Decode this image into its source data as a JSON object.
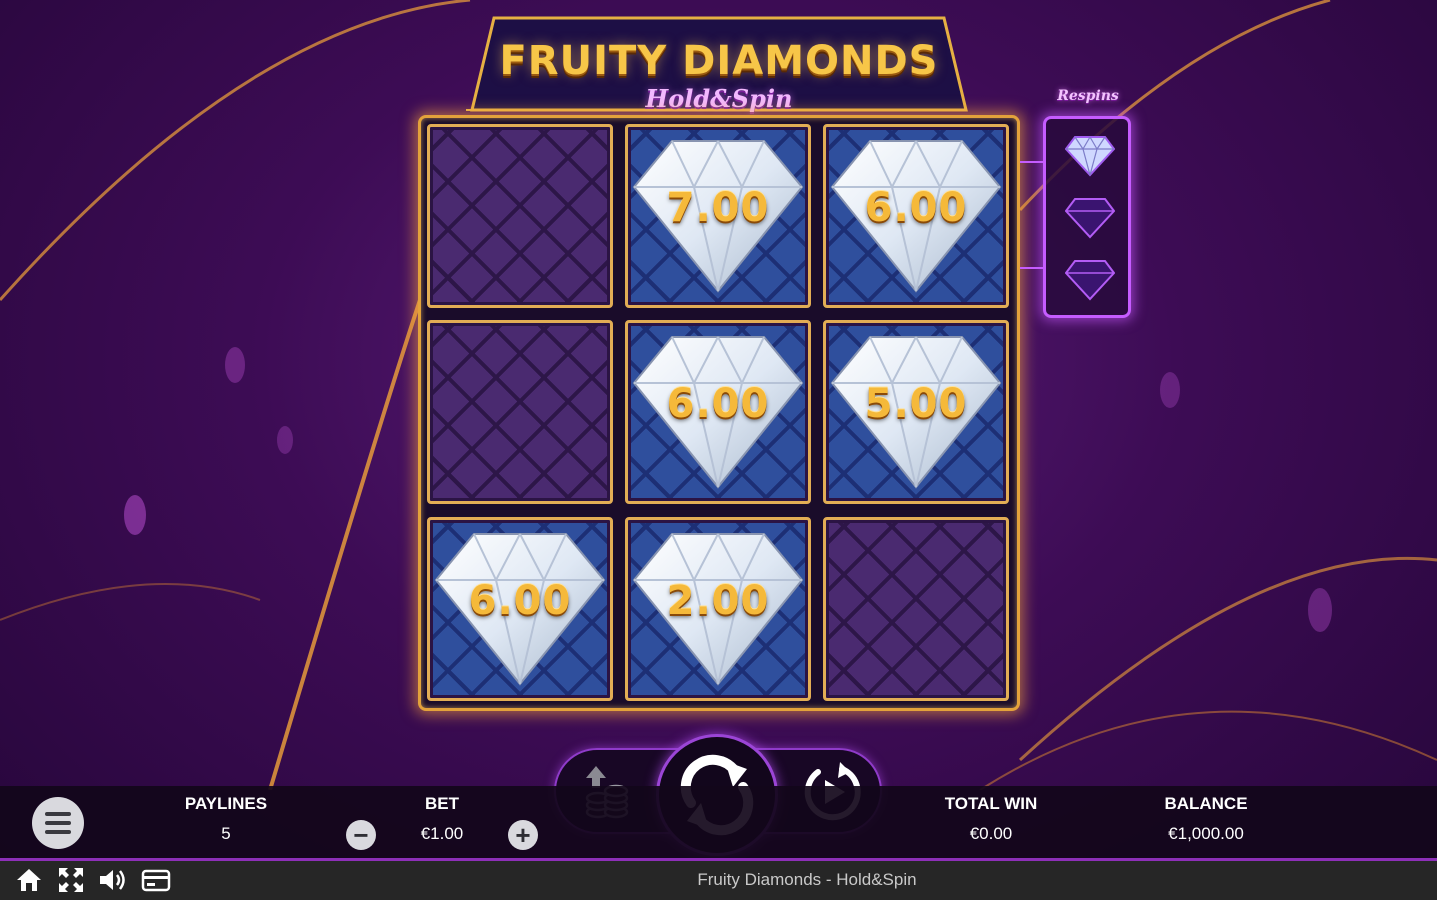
{
  "game": {
    "title_main": "FRUITY DIAMONDS",
    "title_sub": "Hold&Spin"
  },
  "grid": {
    "cells": [
      {
        "row": 0,
        "col": 0,
        "type": "empty",
        "value": ""
      },
      {
        "row": 0,
        "col": 1,
        "type": "diamond",
        "value": "7.00"
      },
      {
        "row": 0,
        "col": 2,
        "type": "diamond",
        "value": "6.00"
      },
      {
        "row": 1,
        "col": 0,
        "type": "empty",
        "value": ""
      },
      {
        "row": 1,
        "col": 1,
        "type": "diamond",
        "value": "6.00"
      },
      {
        "row": 1,
        "col": 2,
        "type": "diamond",
        "value": "5.00"
      },
      {
        "row": 2,
        "col": 0,
        "type": "diamond",
        "value": "6.00"
      },
      {
        "row": 2,
        "col": 1,
        "type": "diamond",
        "value": "2.00"
      },
      {
        "row": 2,
        "col": 2,
        "type": "empty",
        "value": ""
      }
    ]
  },
  "respins": {
    "label": "Respins",
    "total": 3,
    "active": 1,
    "icons": [
      "diamond-lit-icon",
      "diamond-outline-icon",
      "diamond-outline-icon"
    ]
  },
  "controls": {
    "coins_icon": "coin-stack-icon",
    "spin_icon": "refresh-icon",
    "autoplay_icon": "autoplay-icon"
  },
  "info": {
    "paylines_label": "PAYLINES",
    "paylines_value": "5",
    "bet_label": "BET",
    "bet_value": "€1.00",
    "bet_minus": "−",
    "bet_plus": "+",
    "total_win_label": "TOTAL WIN",
    "total_win_value": "€0.00",
    "balance_label": "BALANCE",
    "balance_value": "€1,000.00"
  },
  "system_bar": {
    "title": "Fruity Diamonds - Hold&Spin",
    "icons": [
      "home-icon",
      "fullscreen-icon",
      "sound-icon",
      "paytable-icon"
    ]
  },
  "colors": {
    "gold": "#f5b93a",
    "purple_glow": "#c55cff",
    "background": "#3d0c55"
  }
}
